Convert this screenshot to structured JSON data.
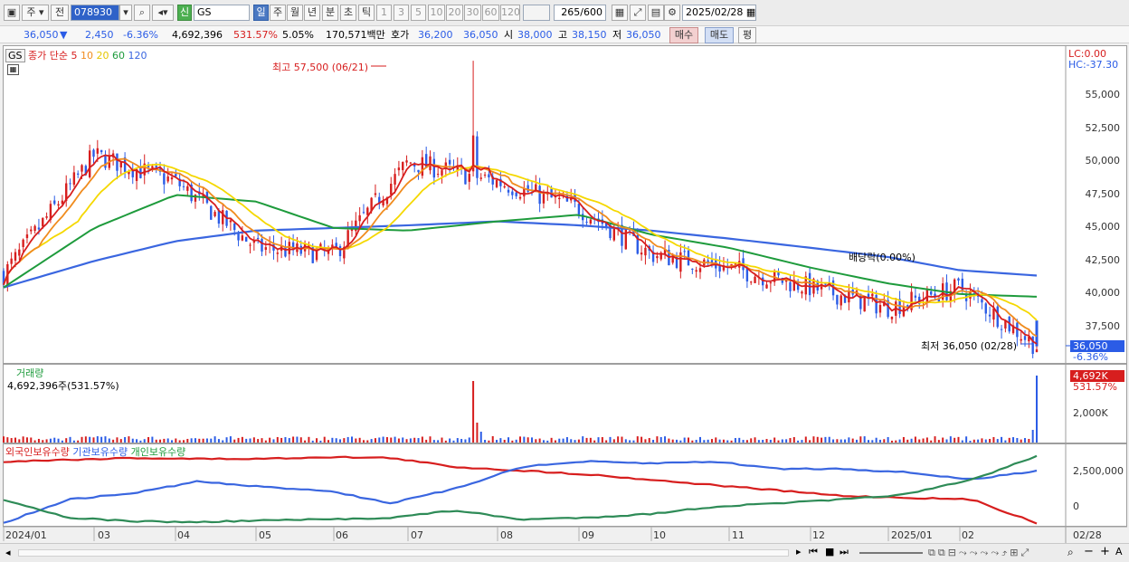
{
  "toolbar": {
    "market_label": "주",
    "prev_label": "전",
    "code": "078930",
    "stock_name": "GS",
    "new_badge": "신",
    "periods": [
      "일",
      "주",
      "월",
      "년",
      "분",
      "초",
      "틱"
    ],
    "intervals": [
      "1",
      "3",
      "5",
      "10",
      "20",
      "30",
      "60",
      "120"
    ],
    "count": "265",
    "count_total": "/600",
    "date": "2025/02/28"
  },
  "quote": {
    "price": "36,050",
    "arrow": "▼",
    "change": "2,450",
    "change_pct": "-6.36%",
    "volume": "4,692,396",
    "volume_ratio": "531.57%",
    "turnover_pct": "5.05%",
    "amount": "170,571백만",
    "ask_label": "호가",
    "ask": "36,200",
    "bid": "36,050",
    "open_label": "시",
    "open": "38,000",
    "high_label": "고",
    "high": "38,150",
    "low_label": "저",
    "low": "36,050",
    "buy_label": "매수",
    "sell_label": "매도",
    "avg_label": "평"
  },
  "price_panel": {
    "tag": "GS",
    "legend_prefix": "종가 단순",
    "ma_labels": [
      "5",
      "10",
      "20",
      "60",
      "120"
    ],
    "lc": "LC:0.00",
    "hc": "HC:-37.30",
    "high_note": "최고 57,500 (06/21)",
    "low_note": "최저 36,050 (02/28)",
    "dividend_note": "배당락(0.00%)",
    "last_price": "36,050",
    "last_pct": "-6.36%",
    "y_ticks": [
      "55,000",
      "52,500",
      "50,000",
      "47,500",
      "45,000",
      "42,500",
      "40,000",
      "37,500"
    ]
  },
  "volume_panel": {
    "title": "거래량",
    "value": "4,692,396주(531.57%)",
    "last_value": "4,692K",
    "last_pct": "531.57%",
    "y_tick": "2,000K"
  },
  "holdings_panel": {
    "legend": [
      "외국인보유수량",
      "기관보유수량",
      "개인보유수량"
    ],
    "y_ticks": [
      "2,500,000",
      "0"
    ]
  },
  "x_ticks": [
    "2024/01",
    "03",
    "04",
    "05",
    "06",
    "07",
    "08",
    "09",
    "10",
    "11",
    "12",
    "2025/01",
    "02",
    "02/28"
  ],
  "colors": {
    "up": "#d71e1e",
    "down": "#2b5ce6",
    "ma5": "#d71e1e",
    "ma10": "#f08c1e",
    "ma20": "#f5d800",
    "ma60": "#1e9b3c",
    "ma120": "#3a66e0",
    "foreign": "#3a66e0",
    "institution": "#d71e1e",
    "individual": "#2e8b57"
  },
  "chart_data": [
    {
      "type": "line",
      "title": "GS",
      "ylim": [
        35000,
        58000
      ],
      "x": [
        "2024/01",
        "03",
        "04",
        "05",
        "06",
        "07",
        "08",
        "09",
        "10",
        "11",
        "12",
        "2025/01",
        "02",
        "02/28"
      ],
      "series": [
        {
          "name": "종가",
          "values": [
            41500,
            50500,
            48500,
            43500,
            43000,
            50000,
            48500,
            46500,
            43000,
            42000,
            40500,
            39000,
            40500,
            36050
          ]
        },
        {
          "name": "120",
          "values": [
            40500,
            42500,
            44000,
            44800,
            45000,
            45200,
            45500,
            45200,
            44800,
            44200,
            43500,
            42800,
            41800,
            41400
          ]
        },
        {
          "name": "60",
          "values": [
            40500,
            45000,
            47500,
            47000,
            45000,
            44800,
            45500,
            46000,
            44500,
            43500,
            42000,
            40800,
            40000,
            39800
          ]
        }
      ]
    },
    {
      "type": "bar",
      "title": "거래량",
      "annotations": [
        "4,692,396주(531.57%)"
      ]
    }
  ]
}
